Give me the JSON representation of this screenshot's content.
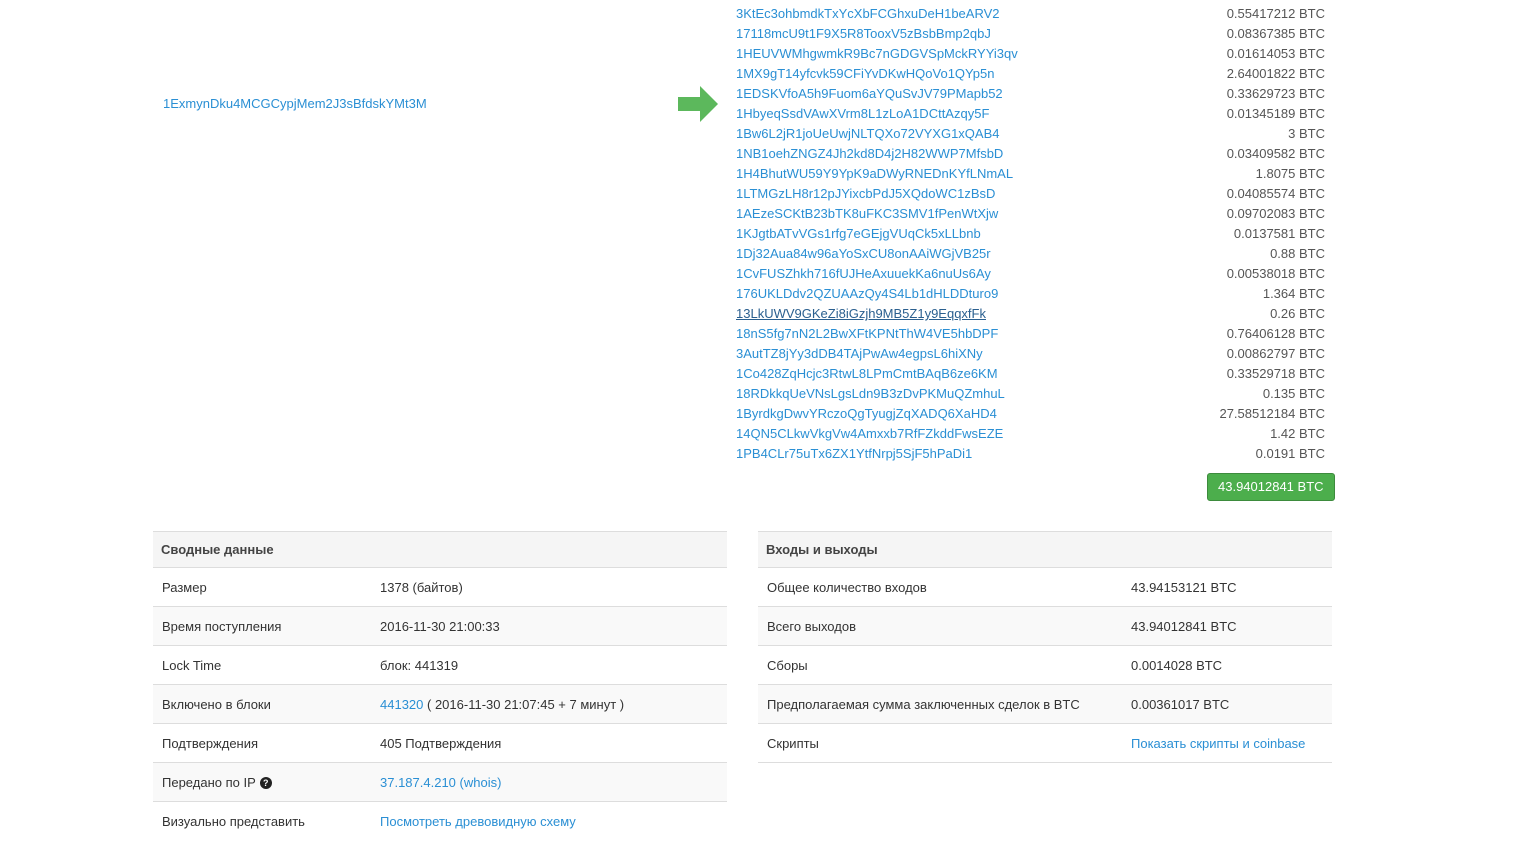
{
  "input_address": "1ExmynDku4MCGCypjMem2J3sBfdskYMt3M",
  "outputs": [
    {
      "address": "3KtEc3ohbmdkTxYcXbFCGhxuDeH1beARV2",
      "amount": "0.55417212 BTC"
    },
    {
      "address": "17118mcU9t1F9X5R8TooxV5zBsbBmp2qbJ",
      "amount": "0.08367385 BTC"
    },
    {
      "address": "1HEUVWMhgwmkR9Bc7nGDGVSpMckRYYi3qv",
      "amount": "0.01614053 BTC"
    },
    {
      "address": "1MX9gT14yfcvk59CFiYvDKwHQoVo1QYp5n",
      "amount": "2.64001822 BTC"
    },
    {
      "address": "1EDSKVfoA5h9Fuom6aYQuSvJV79PMapb52",
      "amount": "0.33629723 BTC"
    },
    {
      "address": "1HbyeqSsdVAwXVrm8L1zLoA1DCttAzqy5F",
      "amount": "0.01345189 BTC"
    },
    {
      "address": "1Bw6L2jR1joUeUwjNLTQXo72VYXG1xQAB4",
      "amount": "3 BTC"
    },
    {
      "address": "1NB1oehZNGZ4Jh2kd8D4j2H82WWP7MfsbD",
      "amount": "0.03409582 BTC"
    },
    {
      "address": "1H4BhutWU59Y9YpK9aDWyRNEDnKYfLNmAL",
      "amount": "1.8075 BTC"
    },
    {
      "address": "1LTMGzLH8r12pJYixcbPdJ5XQdoWC1zBsD",
      "amount": "0.04085574 BTC"
    },
    {
      "address": "1AEzeSCKtB23bTK8uFKC3SMV1fPenWtXjw",
      "amount": "0.09702083 BTC"
    },
    {
      "address": "1KJgtbATvVGs1rfg7eGEjgVUqCk5xLLbnb",
      "amount": "0.0137581 BTC"
    },
    {
      "address": "1Dj32Aua84w96aYoSxCU8onAAiWGjVB25r",
      "amount": "0.88 BTC"
    },
    {
      "address": "1CvFUSZhkh716fUJHeAxuuekKa6nuUs6Ay",
      "amount": "0.00538018 BTC"
    },
    {
      "address": "176UKLDdv2QZUAAzQy4S4Lb1dHLDDturo9",
      "amount": "1.364 BTC"
    },
    {
      "address": "13LkUWV9GKeZi8iGzjh9MB5Z1y9EqqxfFk",
      "amount": "0.26 BTC"
    },
    {
      "address": "18nS5fg7nN2L2BwXFtKPNtThW4VE5hbDPF",
      "amount": "0.76406128 BTC"
    },
    {
      "address": "3AutTZ8jYy3dDB4TAjPwAw4egpsL6hiXNy",
      "amount": "0.00862797 BTC"
    },
    {
      "address": "1Co428ZqHcjc3RtwL8LPmCmtBAqB6ze6KM",
      "amount": "0.33529718 BTC"
    },
    {
      "address": "18RDkkqUeVNsLgsLdn9B3zDvPKMuQZmhuL",
      "amount": "0.135 BTC"
    },
    {
      "address": "1ByrdkgDwvYRczoQgTyugjZqXADQ6XaHD4",
      "amount": "27.58512184 BTC"
    },
    {
      "address": "14QN5CLkwVkgVw4Amxxb7RfFZkddFwsEZE",
      "amount": "1.42 BTC"
    },
    {
      "address": "1PB4CLr75uTx6ZX1YtfNrpj5SjF5hPaDi1",
      "amount": "0.0191 BTC"
    }
  ],
  "total": "43.94012841 BTC",
  "summary": {
    "title": "Сводные данные",
    "size_label": "Размер",
    "size": "1378 (байтов)",
    "received_label": "Время поступления",
    "received": "2016-11-30 21:00:33",
    "locktime_label": "Lock Time",
    "locktime": "блок: 441319",
    "included_label": "Включено в блоки",
    "block": "441320",
    "block_time": " ( 2016-11-30 21:07:45 + 7 минут )",
    "confirmations_label": "Подтверждения",
    "confirmations": "405 Подтверждения",
    "relayed_label": "Передано по IP",
    "relayed": "37.187.4.210 (whois)",
    "visualize_label": "Визуально представить",
    "visualize": "Посмотреть древовидную схему"
  },
  "io": {
    "title": "Входы и выходы",
    "inputs_label": "Общее количество входов",
    "inputs": "43.94153121 BTC",
    "outputs_label": "Всего выходов",
    "outputs": "43.94012841 BTC",
    "fees_label": "Сборы",
    "fees": "0.0014028 BTC",
    "estimated_label": "Предполагаемая сумма заключенных сделок в BTC",
    "estimated": "0.00361017 BTC",
    "scripts_label": "Скрипты",
    "scripts": "Показать скрипты и coinbase"
  },
  "colors": {
    "link": "#2a8fd4",
    "success": "#4cae4c"
  }
}
